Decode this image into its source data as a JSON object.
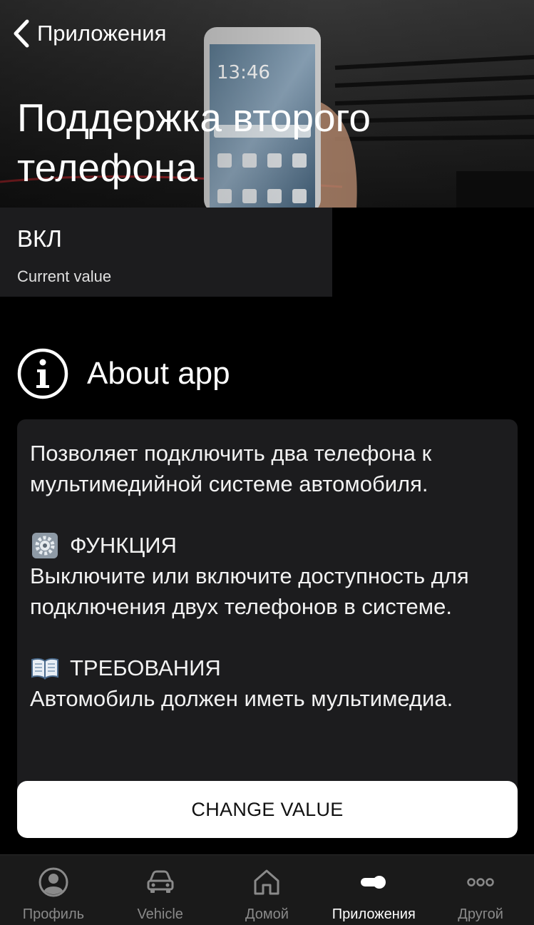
{
  "header": {
    "back_label": "Приложения",
    "title": "Поддержка второго телефона"
  },
  "current_value": {
    "value": "ВКЛ",
    "caption": "Current value"
  },
  "about": {
    "title": "About app",
    "intro": "Позволяет подключить два телефона к мультимедийной системе автомобиля.",
    "function_heading": "ФУНКЦИЯ",
    "function_text": "Выключите или включите доступность для подключения двух телефонов в системе.",
    "requirements_heading": "ТРЕБОВАНИЯ",
    "requirements_text": "Автомобиль должен иметь мультимедиа."
  },
  "actions": {
    "change_value_label": "CHANGE VALUE"
  },
  "tabbar": {
    "tabs": [
      {
        "label": "Профиль",
        "icon": "profile-icon",
        "active": false
      },
      {
        "label": "Vehicle",
        "icon": "car-icon",
        "active": false
      },
      {
        "label": "Домой",
        "icon": "home-icon",
        "active": false
      },
      {
        "label": "Приложения",
        "icon": "toggle-icon",
        "active": true
      },
      {
        "label": "Другой",
        "icon": "more-icon",
        "active": false
      }
    ]
  },
  "colors": {
    "background": "#000000",
    "card": "#1c1c1e",
    "tabbar": "#1a1a1a",
    "inactive_tab": "#8a8a8a",
    "button_bg": "#ffffff"
  }
}
